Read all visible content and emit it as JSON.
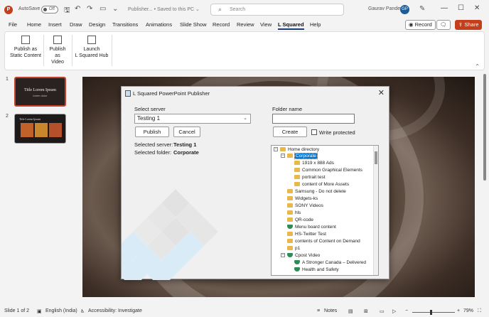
{
  "titlebar": {
    "logo": "P",
    "autosave_label": "AutoSave",
    "autosave_state": "Off",
    "file_title": "Publisher... • Saved to this PC ⌄",
    "search_placeholder": "Search",
    "user_name": "Gaurav Pandey",
    "user_initials": "GP"
  },
  "menu": {
    "items": [
      "File",
      "Home",
      "Insert",
      "Draw",
      "Design",
      "Transitions",
      "Animations",
      "Slide Show",
      "Record",
      "Review",
      "View",
      "L Squared",
      "Help"
    ],
    "active": "L Squared",
    "record_label": "Record",
    "share_label": "Share"
  },
  "ribbon": {
    "buttons": [
      {
        "line1": "Publish as",
        "line2": "Static Content"
      },
      {
        "line1": "Publish as",
        "line2": "Video"
      },
      {
        "line1": "Launch",
        "line2": "L Squared Hub"
      }
    ]
  },
  "slides": {
    "thumb1_title": "Title Lorem Ipsum",
    "thumb1_sub": "lorem dolor",
    "thumb2_title": "Title Lorem Ipsum"
  },
  "dialog": {
    "title": "L Squared PowerPoint Publisher",
    "server_label": "Select server",
    "server_value": "Testing 1",
    "publish_label": "Publish",
    "cancel_label": "Cancel",
    "selected_server_label": "Selected server:",
    "selected_server_value": "Testing 1",
    "selected_folder_label": "Selected folder:",
    "selected_folder_value": "Corporate",
    "folder_name_label": "Folder name",
    "create_label": "Create",
    "write_protected_label": "Write protected",
    "tree": [
      "Home directory",
      "Corporate",
      "1919 x 888 Ads",
      "Common Graphical Elements",
      "portrait test",
      "content of More Assets",
      "Samsung - Do not delete",
      "Widgets-ks",
      "SONY Videos",
      "hls",
      "QR-code",
      "Menu board content",
      "HS-Twitter Test",
      "contents of Content on Demand",
      "p1",
      "Cpost Video",
      "A Stronger Canada – Delivered",
      "Health and Safety"
    ]
  },
  "status": {
    "slide": "Slide 1 of 2",
    "language": "English (India)",
    "accessibility": "Accessibility: Investigate",
    "notes": "Notes",
    "zoom": "79%"
  }
}
